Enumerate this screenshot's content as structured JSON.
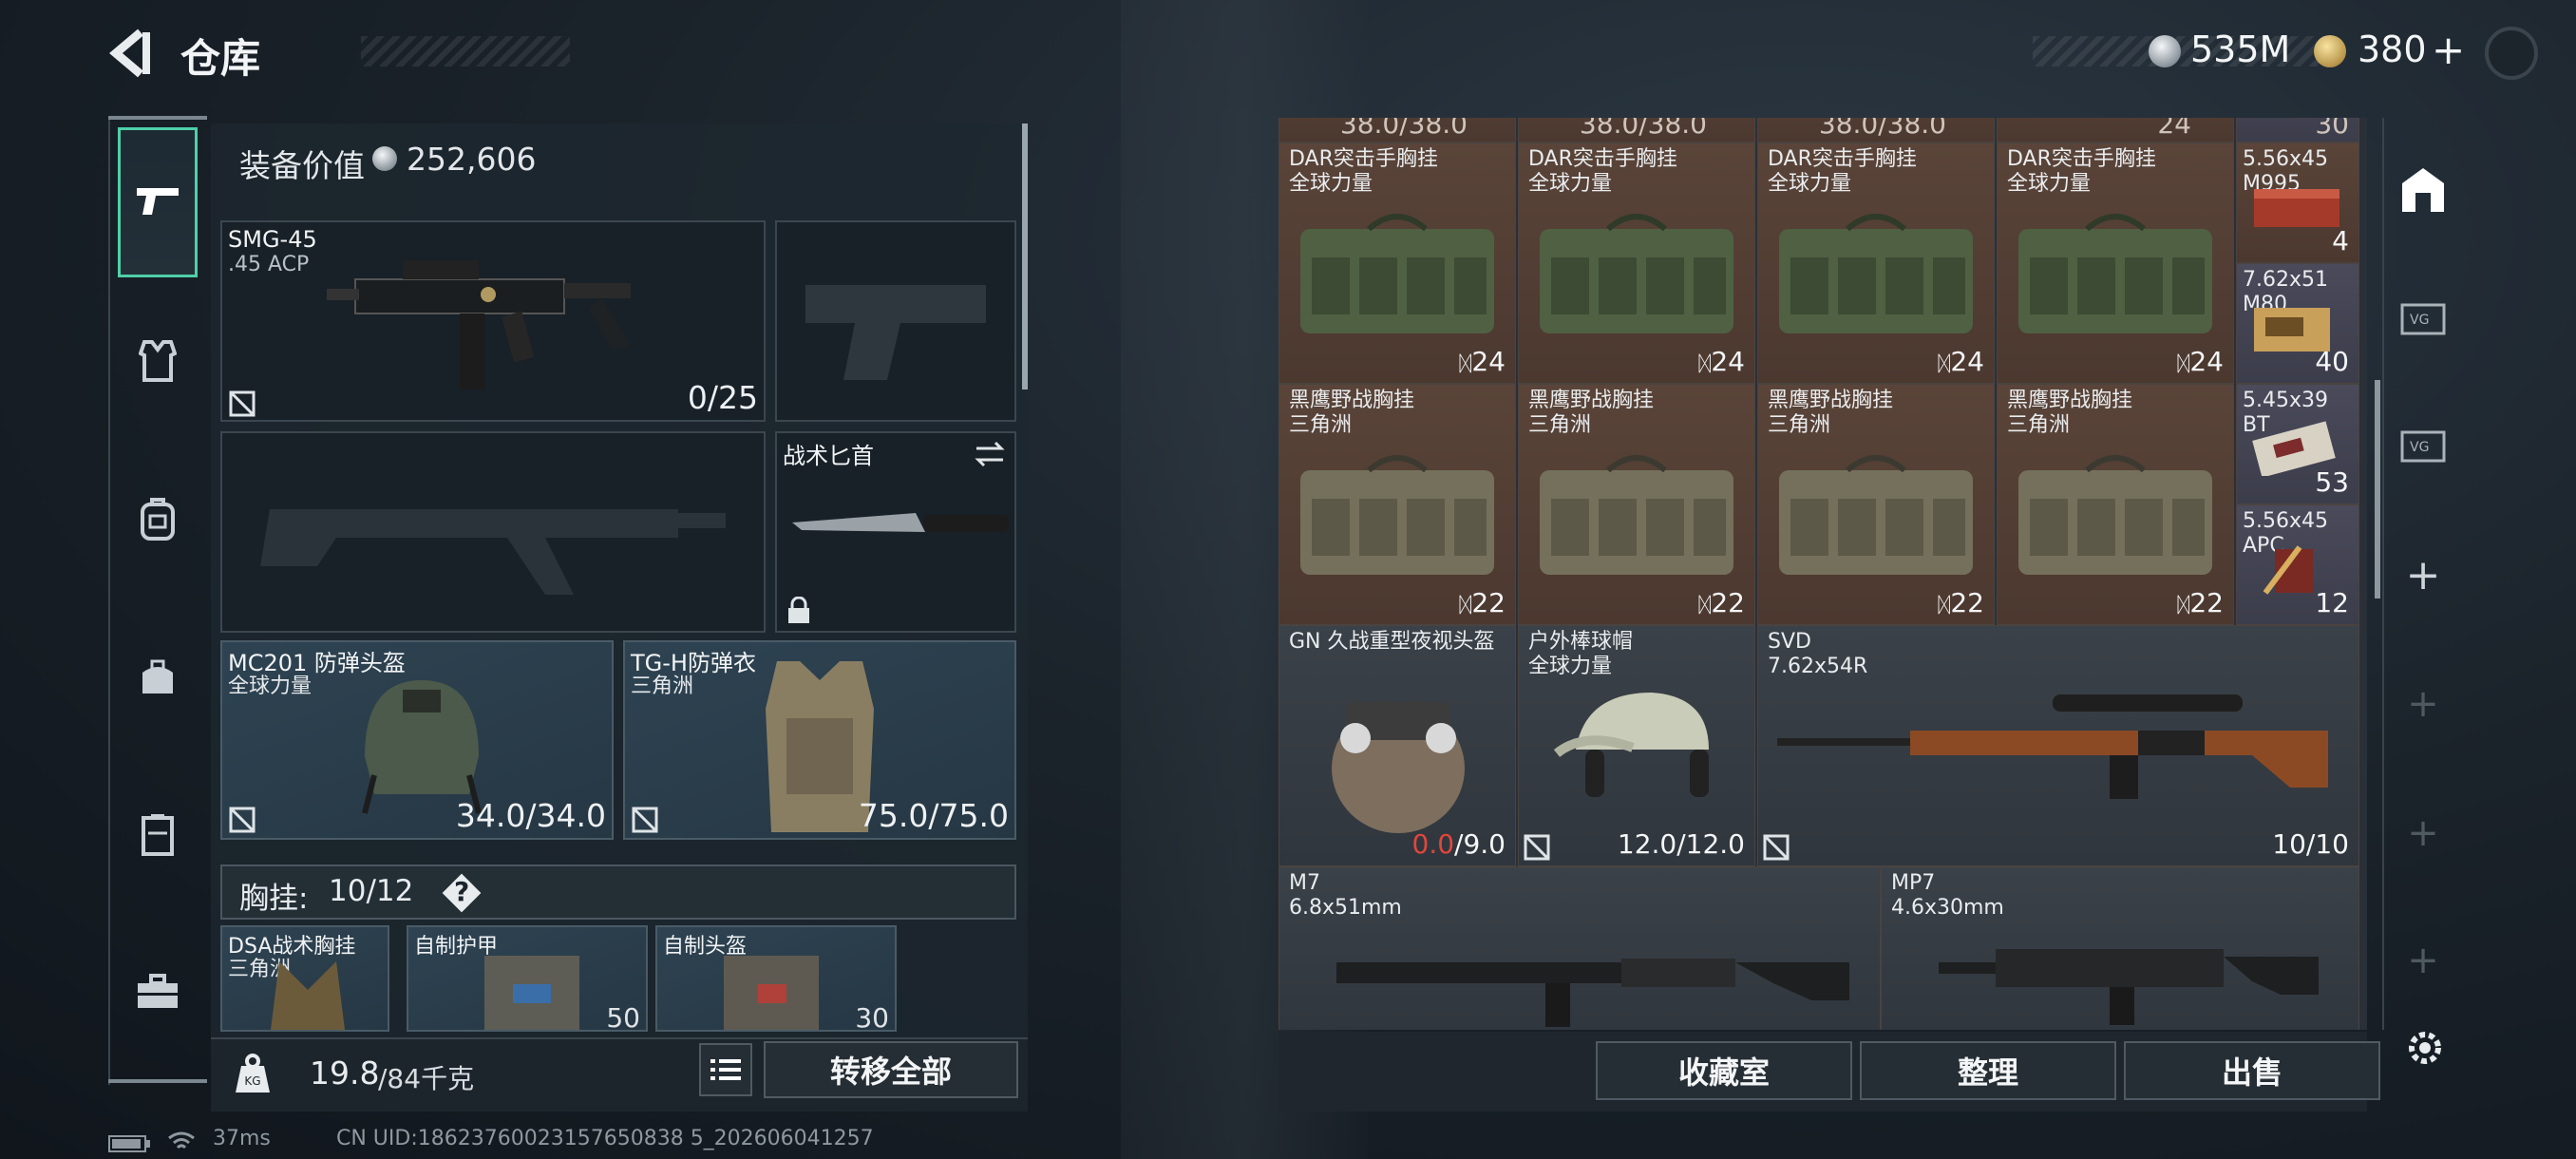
{
  "header": {
    "title": "仓库",
    "currency_silver": "535M",
    "currency_gold": "380",
    "currency_gold_add": "+"
  },
  "equipment": {
    "value_label": "装备价值",
    "value": "252,606",
    "primary_weapon": {
      "name": "SMG-45",
      "caliber": ".45 ACP",
      "ammo": "0/25"
    },
    "melee": {
      "name": "战术匕首"
    },
    "helmet": {
      "name": "MC201 防弹头盔",
      "faction": "全球力量",
      "durability": "34.0/34.0"
    },
    "armor": {
      "name": "TG-H防弹衣",
      "faction": "三角洲",
      "durability": "75.0/75.0"
    },
    "rig_label": "胸挂:",
    "rig_capacity": "10/12",
    "rig_help": "?",
    "rig_items": [
      {
        "name": "DSA战术胸挂",
        "faction": "三角洲"
      },
      {
        "name": "自制护甲",
        "value": "50"
      },
      {
        "name": "自制头盔",
        "value": "30"
      }
    ]
  },
  "bottom": {
    "weight": "19.8",
    "weight_max": "/84千克",
    "transfer_all": "转移全部"
  },
  "stash": {
    "row0_partial": [
      "38.0/38.0",
      "38.0/38.0",
      "38.0/38.0",
      "24",
      "30"
    ],
    "rigs_dar": {
      "name": "DAR突击手胸挂",
      "faction": "全球力量",
      "count": "24"
    },
    "rigs_bh": {
      "name": "黑鹰野战胸挂",
      "faction": "三角洲",
      "count": "22"
    },
    "ammo": [
      {
        "name": "5.56x45",
        "type": "M995",
        "count": "4"
      },
      {
        "name": "7.62x51",
        "type": "M80",
        "count": "40"
      },
      {
        "name": "5.45x39",
        "type": "BT",
        "count": "53"
      },
      {
        "name": "5.56x45",
        "type": "APC",
        "count": "12"
      }
    ],
    "nvg_helmet": {
      "name": "GN 久战重型夜视头盔",
      "durability_cur": "0.0",
      "durability_max": "/9.0"
    },
    "cap": {
      "name": "户外棒球帽",
      "faction": "全球力量",
      "durability": "12.0/12.0"
    },
    "svd": {
      "name": "SVD",
      "caliber": "7.62x54R",
      "ammo": "10/10"
    },
    "m7": {
      "name": "M7",
      "caliber": "6.8x51mm"
    },
    "mp7": {
      "name": "MP7",
      "caliber": "4.6x30mm"
    }
  },
  "actions": {
    "collection": "收藏室",
    "sort": "整理",
    "sell": "出售"
  },
  "status": {
    "ping": "37ms",
    "uid": "CN UID:18623760023157650838 5_202606041257"
  },
  "colors": {
    "accent": "#4fd0a8",
    "cell_brown": "#5a4439",
    "broken": "#e0463c"
  }
}
